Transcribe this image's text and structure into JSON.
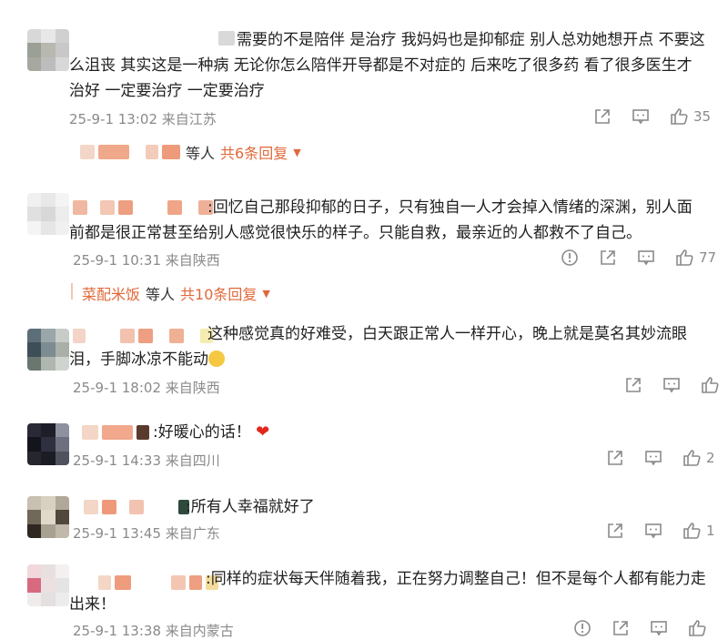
{
  "colors": {
    "accent": "#e0683a",
    "meta": "#8a8a8a",
    "heart": "#e0281e"
  },
  "comments": [
    {
      "text": "需要的不是陪伴 是治疗 我妈妈也是抑郁症 别人总劝她想开点 不要这么沮丧 其实这是一种病 无论你怎么陪伴开导都是不对症的 后来吃了很多药 看了很多医生才治好 一定要治疗 一定要治疗",
      "time": "25-9-1 13:02 来自江苏",
      "likes": "35",
      "replies": {
        "names": "",
        "deng": "等人",
        "total": "共6条回复"
      }
    },
    {
      "text": ":回忆自己那段抑郁的日子，只有独自一人才会掉入情绪的深渊，别人面前都是很正常甚至给别人感觉很快乐的样子。只能自救，最亲近的人都救不了自己。",
      "time": "25-9-1 10:31 来自陕西",
      "likes": "77",
      "replies": {
        "names": "菜配米饭",
        "deng": "等人",
        "total": "共10条回复"
      }
    },
    {
      "text": "这种感觉真的好难受，白天跟正常人一样开心，晚上就是莫名其妙流眼泪，手脚冰凉不能动",
      "time": "25-9-1 18:02 来自陕西",
      "likes": ""
    },
    {
      "text": ":好暖心的话！",
      "time": "25-9-1 14:33 来自四川",
      "likes": "2"
    },
    {
      "text": ":所有人幸福就好了",
      "time": "25-9-1 13:45 来自广东",
      "likes": "1"
    },
    {
      "text": ":同样的症状每天伴随着我，正在努力调整自己！但不是每个人都有能力走出来！",
      "time": "25-9-1 13:38 来自内蒙古",
      "likes": ""
    }
  ],
  "icons": {
    "share": "share-icon",
    "comment": "comment-icon",
    "like": "like-icon",
    "report": "report-icon"
  }
}
